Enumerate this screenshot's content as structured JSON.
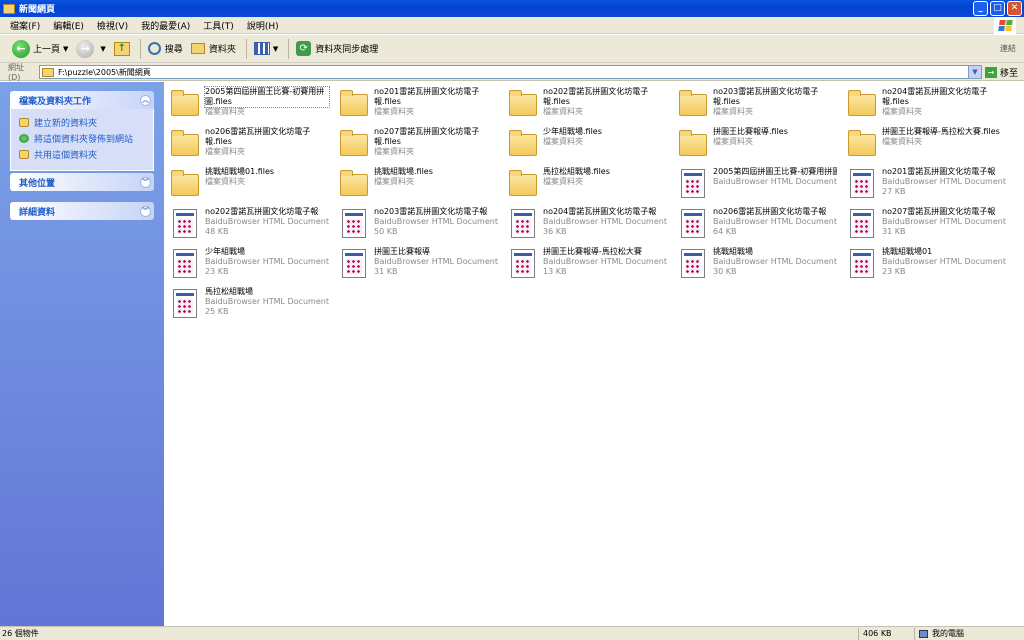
{
  "window": {
    "title": "新聞網頁"
  },
  "menu": [
    "檔案(F)",
    "編輯(E)",
    "檢視(V)",
    "我的最愛(A)",
    "工具(T)",
    "說明(H)"
  ],
  "toolbar": {
    "back": "上一頁",
    "search": "搜尋",
    "folders": "資料夾",
    "sync": "資料夾同步處理",
    "links": "連結"
  },
  "address": {
    "label": "網址(D)",
    "value": "F:\\puzzle\\2005\\新聞網頁",
    "go": "移至"
  },
  "sidebar": {
    "tasks_title": "檔案及資料夾工作",
    "tasks": [
      "建立新的資料夾",
      "將這個資料夾發佈到網站",
      "共用這個資料夾"
    ],
    "other_title": "其他位置",
    "details_title": "詳細資料"
  },
  "items": [
    {
      "name": "2005第四屆拼圖王比賽-初賽用拼圖.files",
      "sub": "檔案資料夾",
      "size": "",
      "kind": "folder"
    },
    {
      "name": "no201雷諾瓦拼圖文化坊電子報.files",
      "sub": "檔案資料夾",
      "size": "",
      "kind": "folder"
    },
    {
      "name": "no202雷諾瓦拼圖文化坊電子報.files",
      "sub": "檔案資料夾",
      "size": "",
      "kind": "folder"
    },
    {
      "name": "no203雷諾瓦拼圖文化坊電子報.files",
      "sub": "檔案資料夾",
      "size": "",
      "kind": "folder"
    },
    {
      "name": "no204雷諾瓦拼圖文化坊電子報.files",
      "sub": "檔案資料夾",
      "size": "",
      "kind": "folder"
    },
    {
      "name": "no206雷諾瓦拼圖文化坊電子報.files",
      "sub": "檔案資料夾",
      "size": "",
      "kind": "folder"
    },
    {
      "name": "no207雷諾瓦拼圖文化坊電子報.files",
      "sub": "檔案資料夾",
      "size": "",
      "kind": "folder"
    },
    {
      "name": "少年組戰場.files",
      "sub": "檔案資料夾",
      "size": "",
      "kind": "folder"
    },
    {
      "name": "拼圖王比賽報導.files",
      "sub": "檔案資料夾",
      "size": "",
      "kind": "folder"
    },
    {
      "name": "拼圖王比賽報導-馬拉松大賽.files",
      "sub": "檔案資料夾",
      "size": "",
      "kind": "folder"
    },
    {
      "name": "挑戰組戰場01.files",
      "sub": "檔案資料夾",
      "size": "",
      "kind": "folder"
    },
    {
      "name": "挑戰組戰場.files",
      "sub": "檔案資料夾",
      "size": "",
      "kind": "folder"
    },
    {
      "name": "馬拉松組戰場.files",
      "sub": "檔案資料夾",
      "size": "",
      "kind": "folder"
    },
    {
      "name": "2005第四屆拼圖王比賽-初賽用拼圖",
      "sub": "BaiduBrowser HTML Document",
      "size": "",
      "kind": "doc"
    },
    {
      "name": "no201雷諾瓦拼圖文化坊電子報",
      "sub": "BaiduBrowser HTML Document",
      "size": "27 KB",
      "kind": "doc"
    },
    {
      "name": "no202雷諾瓦拼圖文化坊電子報",
      "sub": "BaiduBrowser HTML Document",
      "size": "48 KB",
      "kind": "doc"
    },
    {
      "name": "no203雷諾瓦拼圖文化坊電子報",
      "sub": "BaiduBrowser HTML Document",
      "size": "50 KB",
      "kind": "doc"
    },
    {
      "name": "no204雷諾瓦拼圖文化坊電子報",
      "sub": "BaiduBrowser HTML Document",
      "size": "36 KB",
      "kind": "doc"
    },
    {
      "name": "no206雷諾瓦拼圖文化坊電子報",
      "sub": "BaiduBrowser HTML Document",
      "size": "64 KB",
      "kind": "doc"
    },
    {
      "name": "no207雷諾瓦拼圖文化坊電子報",
      "sub": "BaiduBrowser HTML Document",
      "size": "31 KB",
      "kind": "doc"
    },
    {
      "name": "少年組戰場",
      "sub": "BaiduBrowser HTML Document",
      "size": "23 KB",
      "kind": "doc"
    },
    {
      "name": "拼圖王比賽報導",
      "sub": "BaiduBrowser HTML Document",
      "size": "31 KB",
      "kind": "doc"
    },
    {
      "name": "拼圖王比賽報導-馬拉松大賽",
      "sub": "BaiduBrowser HTML Document",
      "size": "13 KB",
      "kind": "doc"
    },
    {
      "name": "挑戰組戰場",
      "sub": "BaiduBrowser HTML Document",
      "size": "30 KB",
      "kind": "doc"
    },
    {
      "name": "挑戰組戰場01",
      "sub": "BaiduBrowser HTML Document",
      "size": "23 KB",
      "kind": "doc"
    },
    {
      "name": "馬拉松組戰場",
      "sub": "BaiduBrowser HTML Document",
      "size": "25 KB",
      "kind": "doc"
    }
  ],
  "status": {
    "count": "26 個物件",
    "size": "406 KB",
    "location": "我的電腦"
  }
}
